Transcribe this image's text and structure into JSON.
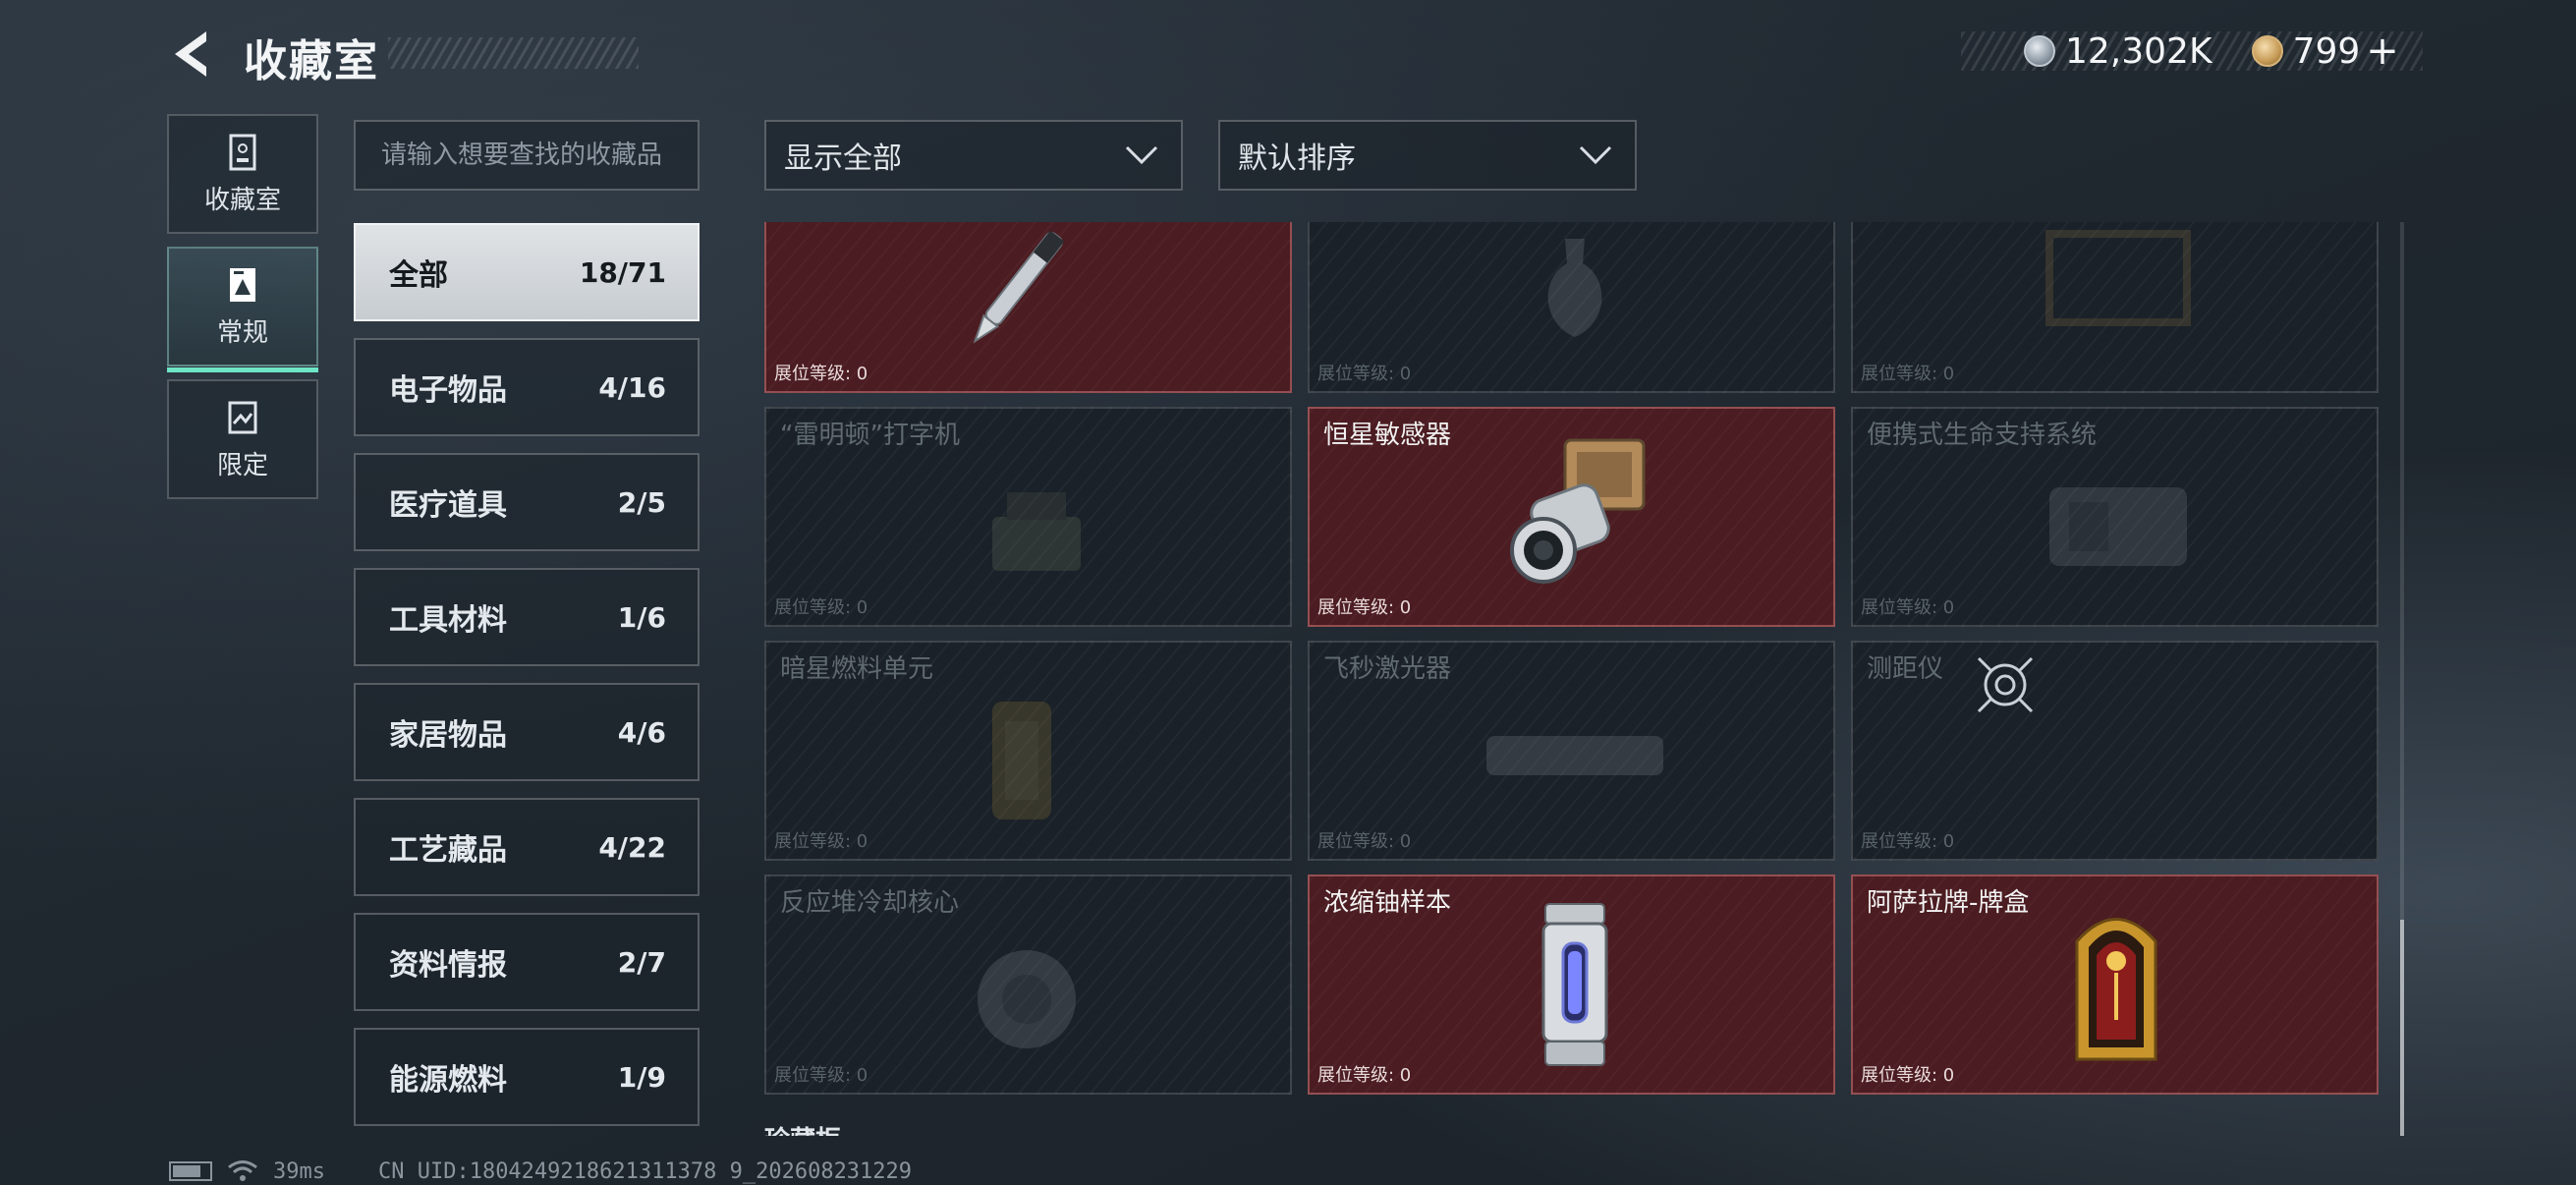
{
  "header": {
    "title": "收藏室",
    "currency_silver": "12,302K",
    "currency_gold": "799",
    "currency_plus": "+"
  },
  "nav": {
    "items": [
      {
        "label": "收藏室",
        "icon": "collection-room-icon"
      },
      {
        "label": "常规",
        "icon": "regular-icon",
        "active": true
      },
      {
        "label": "限定",
        "icon": "limited-icon"
      }
    ]
  },
  "search": {
    "placeholder": "请输入想要查找的收藏品"
  },
  "categories": [
    {
      "label": "全部",
      "count": "18/71",
      "active": true
    },
    {
      "label": "电子物品",
      "count": "4/16"
    },
    {
      "label": "医疗道具",
      "count": "2/5"
    },
    {
      "label": "工具材料",
      "count": "1/6"
    },
    {
      "label": "家居物品",
      "count": "4/6"
    },
    {
      "label": "工艺藏品",
      "count": "4/22"
    },
    {
      "label": "资料情报",
      "count": "2/7"
    },
    {
      "label": "能源燃料",
      "count": "1/9"
    }
  ],
  "filters": {
    "show": "显示全部",
    "sort": "默认排序"
  },
  "level_label": "展位等级: 0",
  "cards": [
    {
      "name": "",
      "unlocked": true,
      "icon": "pen-icon"
    },
    {
      "name": "",
      "unlocked": false,
      "icon": "vase-icon"
    },
    {
      "name": "",
      "unlocked": false,
      "icon": "frame-icon"
    },
    {
      "name": "“雷明顿”打字机",
      "unlocked": false,
      "icon": "typewriter-icon"
    },
    {
      "name": "恒星敏感器",
      "unlocked": true,
      "icon": "star-sensor-icon"
    },
    {
      "name": "便携式生命支持系统",
      "unlocked": false,
      "icon": "life-support-icon"
    },
    {
      "name": "暗星燃料单元",
      "unlocked": false,
      "icon": "fuel-cell-icon"
    },
    {
      "name": "飞秒激光器",
      "unlocked": false,
      "icon": "laser-icon"
    },
    {
      "name": "测距仪",
      "unlocked": false,
      "icon": "rangefinder-icon"
    },
    {
      "name": "反应堆冷却核心",
      "unlocked": false,
      "icon": "reactor-core-icon"
    },
    {
      "name": "浓缩铀样本",
      "unlocked": true,
      "icon": "uranium-sample-icon"
    },
    {
      "name": "阿萨拉牌-牌盒",
      "unlocked": true,
      "icon": "card-box-icon"
    }
  ],
  "section_peek": "珍藏柜",
  "footer": {
    "ping": "39ms",
    "uid": "CN UID:1804249218621311378 9_202608231229"
  }
}
